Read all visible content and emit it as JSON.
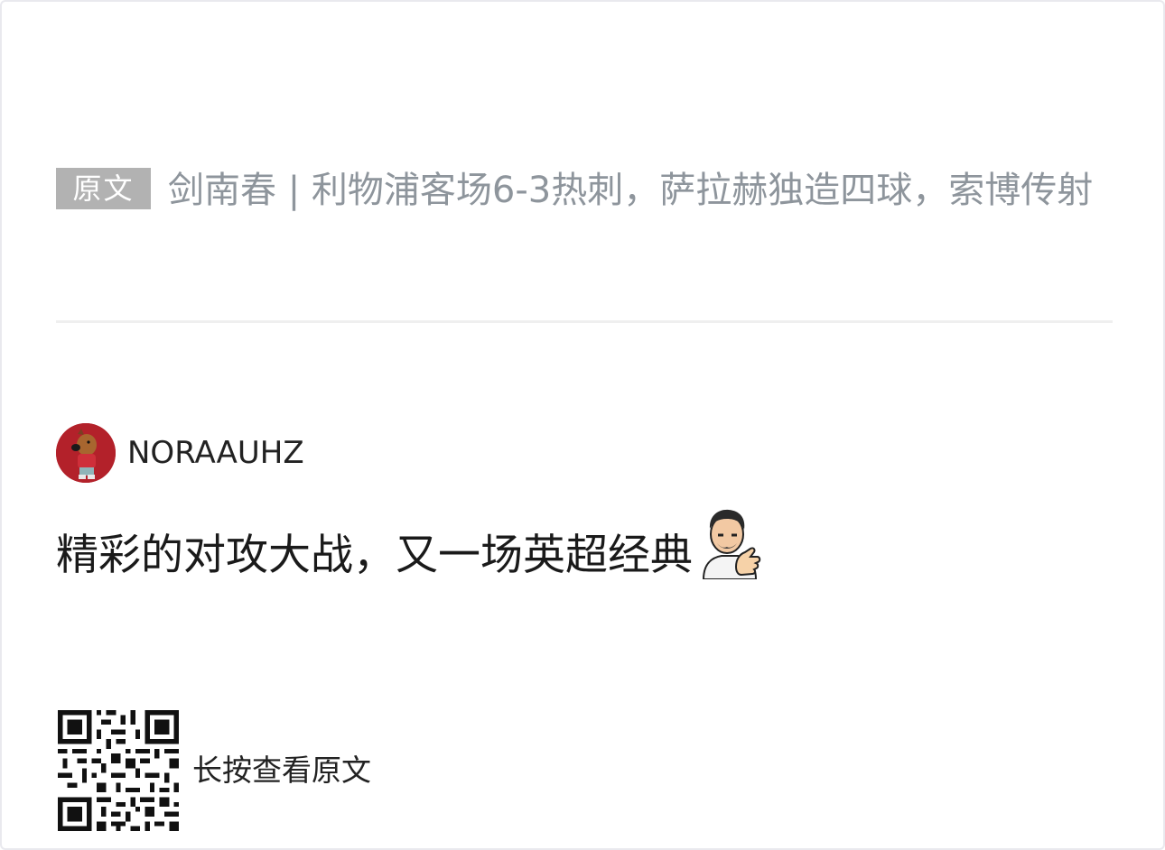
{
  "source": {
    "badge": "原文",
    "title": "剑南春 | 利物浦客场6-3热刺，萨拉赫独造四球，索博传射"
  },
  "comment": {
    "username": "NORAAUHZ",
    "text": "精彩的对攻大战，又一场英超经典",
    "sticker_icon": "thumbs-up-man-sticker"
  },
  "footer": {
    "qr_label": "长按查看原文"
  }
}
